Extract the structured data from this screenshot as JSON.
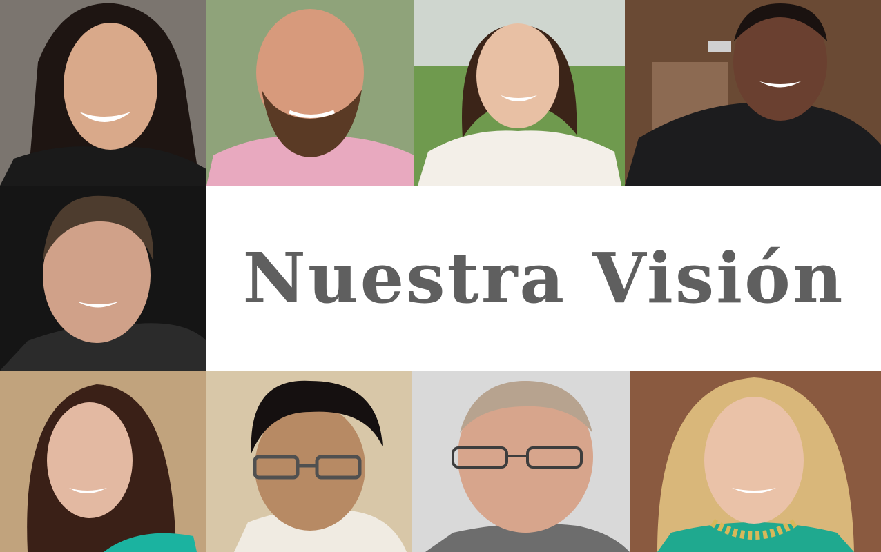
{
  "title": {
    "text": "Nuestra Visión",
    "color": "#5f5f5f"
  },
  "photos": [
    {
      "name": "portrait-woman-smiling-top-left",
      "bg": "#7b756f",
      "skin": "#d9a98a",
      "hair": "#1e1512",
      "shirt": "#1a1a1a"
    },
    {
      "name": "portrait-bearded-man-pink-shirt",
      "bg": "#8fa37a",
      "skin": "#d79a7c",
      "hair": "#5a3a25",
      "shirt": "#e8a9bf"
    },
    {
      "name": "portrait-young-woman-outdoors",
      "bg": "#6f9a4e",
      "skin": "#e8c0a4",
      "hair": "#3b2418",
      "shirt": "#f3efe8"
    },
    {
      "name": "portrait-smiling-man-dark-shirt",
      "bg": "#6a4a34",
      "skin": "#6a4030",
      "hair": "#1a1210",
      "shirt": "#1c1c1e"
    },
    {
      "name": "portrait-man-dark-jacket",
      "bg": "#151515",
      "skin": "#d0a189",
      "hair": "#4d3c2e",
      "shirt": "#2b2b2b"
    },
    {
      "name": "portrait-woman-long-dark-hair",
      "bg": "#c1a37d",
      "skin": "#e3b9a2",
      "hair": "#3a2017",
      "shirt": "#1bb3a0"
    },
    {
      "name": "portrait-man-glasses-striped-shirt",
      "bg": "#d8c7a8",
      "skin": "#b78a64",
      "hair": "#151010",
      "shirt": "#f0ebe2"
    },
    {
      "name": "portrait-older-man-glasses",
      "bg": "#d9d9d9",
      "skin": "#d7a58c",
      "hair": "#b7a38f",
      "shirt": "#6d6d6d"
    },
    {
      "name": "portrait-blonde-woman-necklace",
      "bg": "#8a5a40",
      "skin": "#eac2a8",
      "hair": "#d9b77a",
      "shirt": "#1fa98f"
    }
  ]
}
